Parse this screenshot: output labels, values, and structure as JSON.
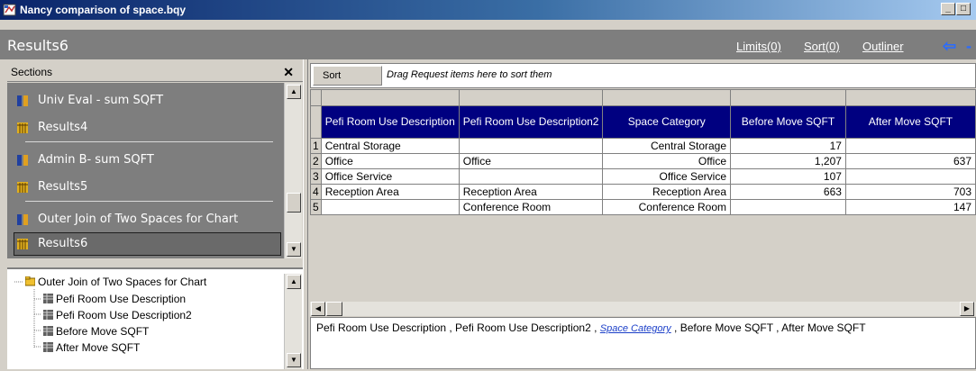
{
  "window": {
    "title": "Nancy comparison of space.bqy",
    "minimize": "_",
    "restore": "□"
  },
  "header": {
    "title": "Results6",
    "limits": "Limits(0)",
    "sort": "Sort(0)",
    "outliner": "Outliner",
    "back_arrow": "⇦",
    "more_arrow": "-"
  },
  "sections": {
    "label": "Sections",
    "close": "✕",
    "items": [
      {
        "label": "Univ Eval - sum SQFT",
        "icon": "query-icon"
      },
      {
        "label": "Results4",
        "icon": "results-icon"
      },
      {
        "label": "Admin B- sum SQFT",
        "icon": "query-icon"
      },
      {
        "label": "Results5",
        "icon": "results-icon"
      },
      {
        "label": "Outer Join of Two Spaces for Chart",
        "icon": "query-icon"
      },
      {
        "label": "Results6",
        "icon": "results-icon",
        "selected": true
      }
    ]
  },
  "tree": {
    "root": "Outer Join of Two Spaces for Chart",
    "children": [
      "Pefi Room Use Description",
      "Pefi Room Use Description2",
      "Before Move SQFT",
      "After Move SQFT"
    ]
  },
  "sortbar": {
    "button": "Sort",
    "hint": "Drag Request items here to sort them"
  },
  "table": {
    "columns": [
      "Pefi Room Use Description",
      "Pefi Room Use Description2",
      "Space Category",
      "Before Move SQFT",
      "After Move SQFT"
    ],
    "rows": [
      {
        "n": "1",
        "c1": "Central Storage",
        "c2": "",
        "c3": "Central Storage",
        "c4": "17",
        "c5": ""
      },
      {
        "n": "2",
        "c1": "Office",
        "c2": "Office",
        "c3": "Office",
        "c4": "1,207",
        "c5": "637"
      },
      {
        "n": "3",
        "c1": "Office Service",
        "c2": "",
        "c3": "Office Service",
        "c4": "107",
        "c5": ""
      },
      {
        "n": "4",
        "c1": "Reception Area",
        "c2": "Reception Area",
        "c3": "Reception Area",
        "c4": "663",
        "c5": "703"
      },
      {
        "n": "5",
        "c1": "",
        "c2": "Conference Room",
        "c3": "Conference Room",
        "c4": "",
        "c5": "147"
      }
    ]
  },
  "columnbar": {
    "part1": "Pefi Room Use Description , Pefi Room Use Description2 , ",
    "link": "Space Category",
    "part2": " , Before Move SQFT , After Move SQFT"
  },
  "colors": {
    "header_bg": "#000080",
    "section_bg": "#7e7e7e",
    "title_bar": "#0a246a"
  }
}
